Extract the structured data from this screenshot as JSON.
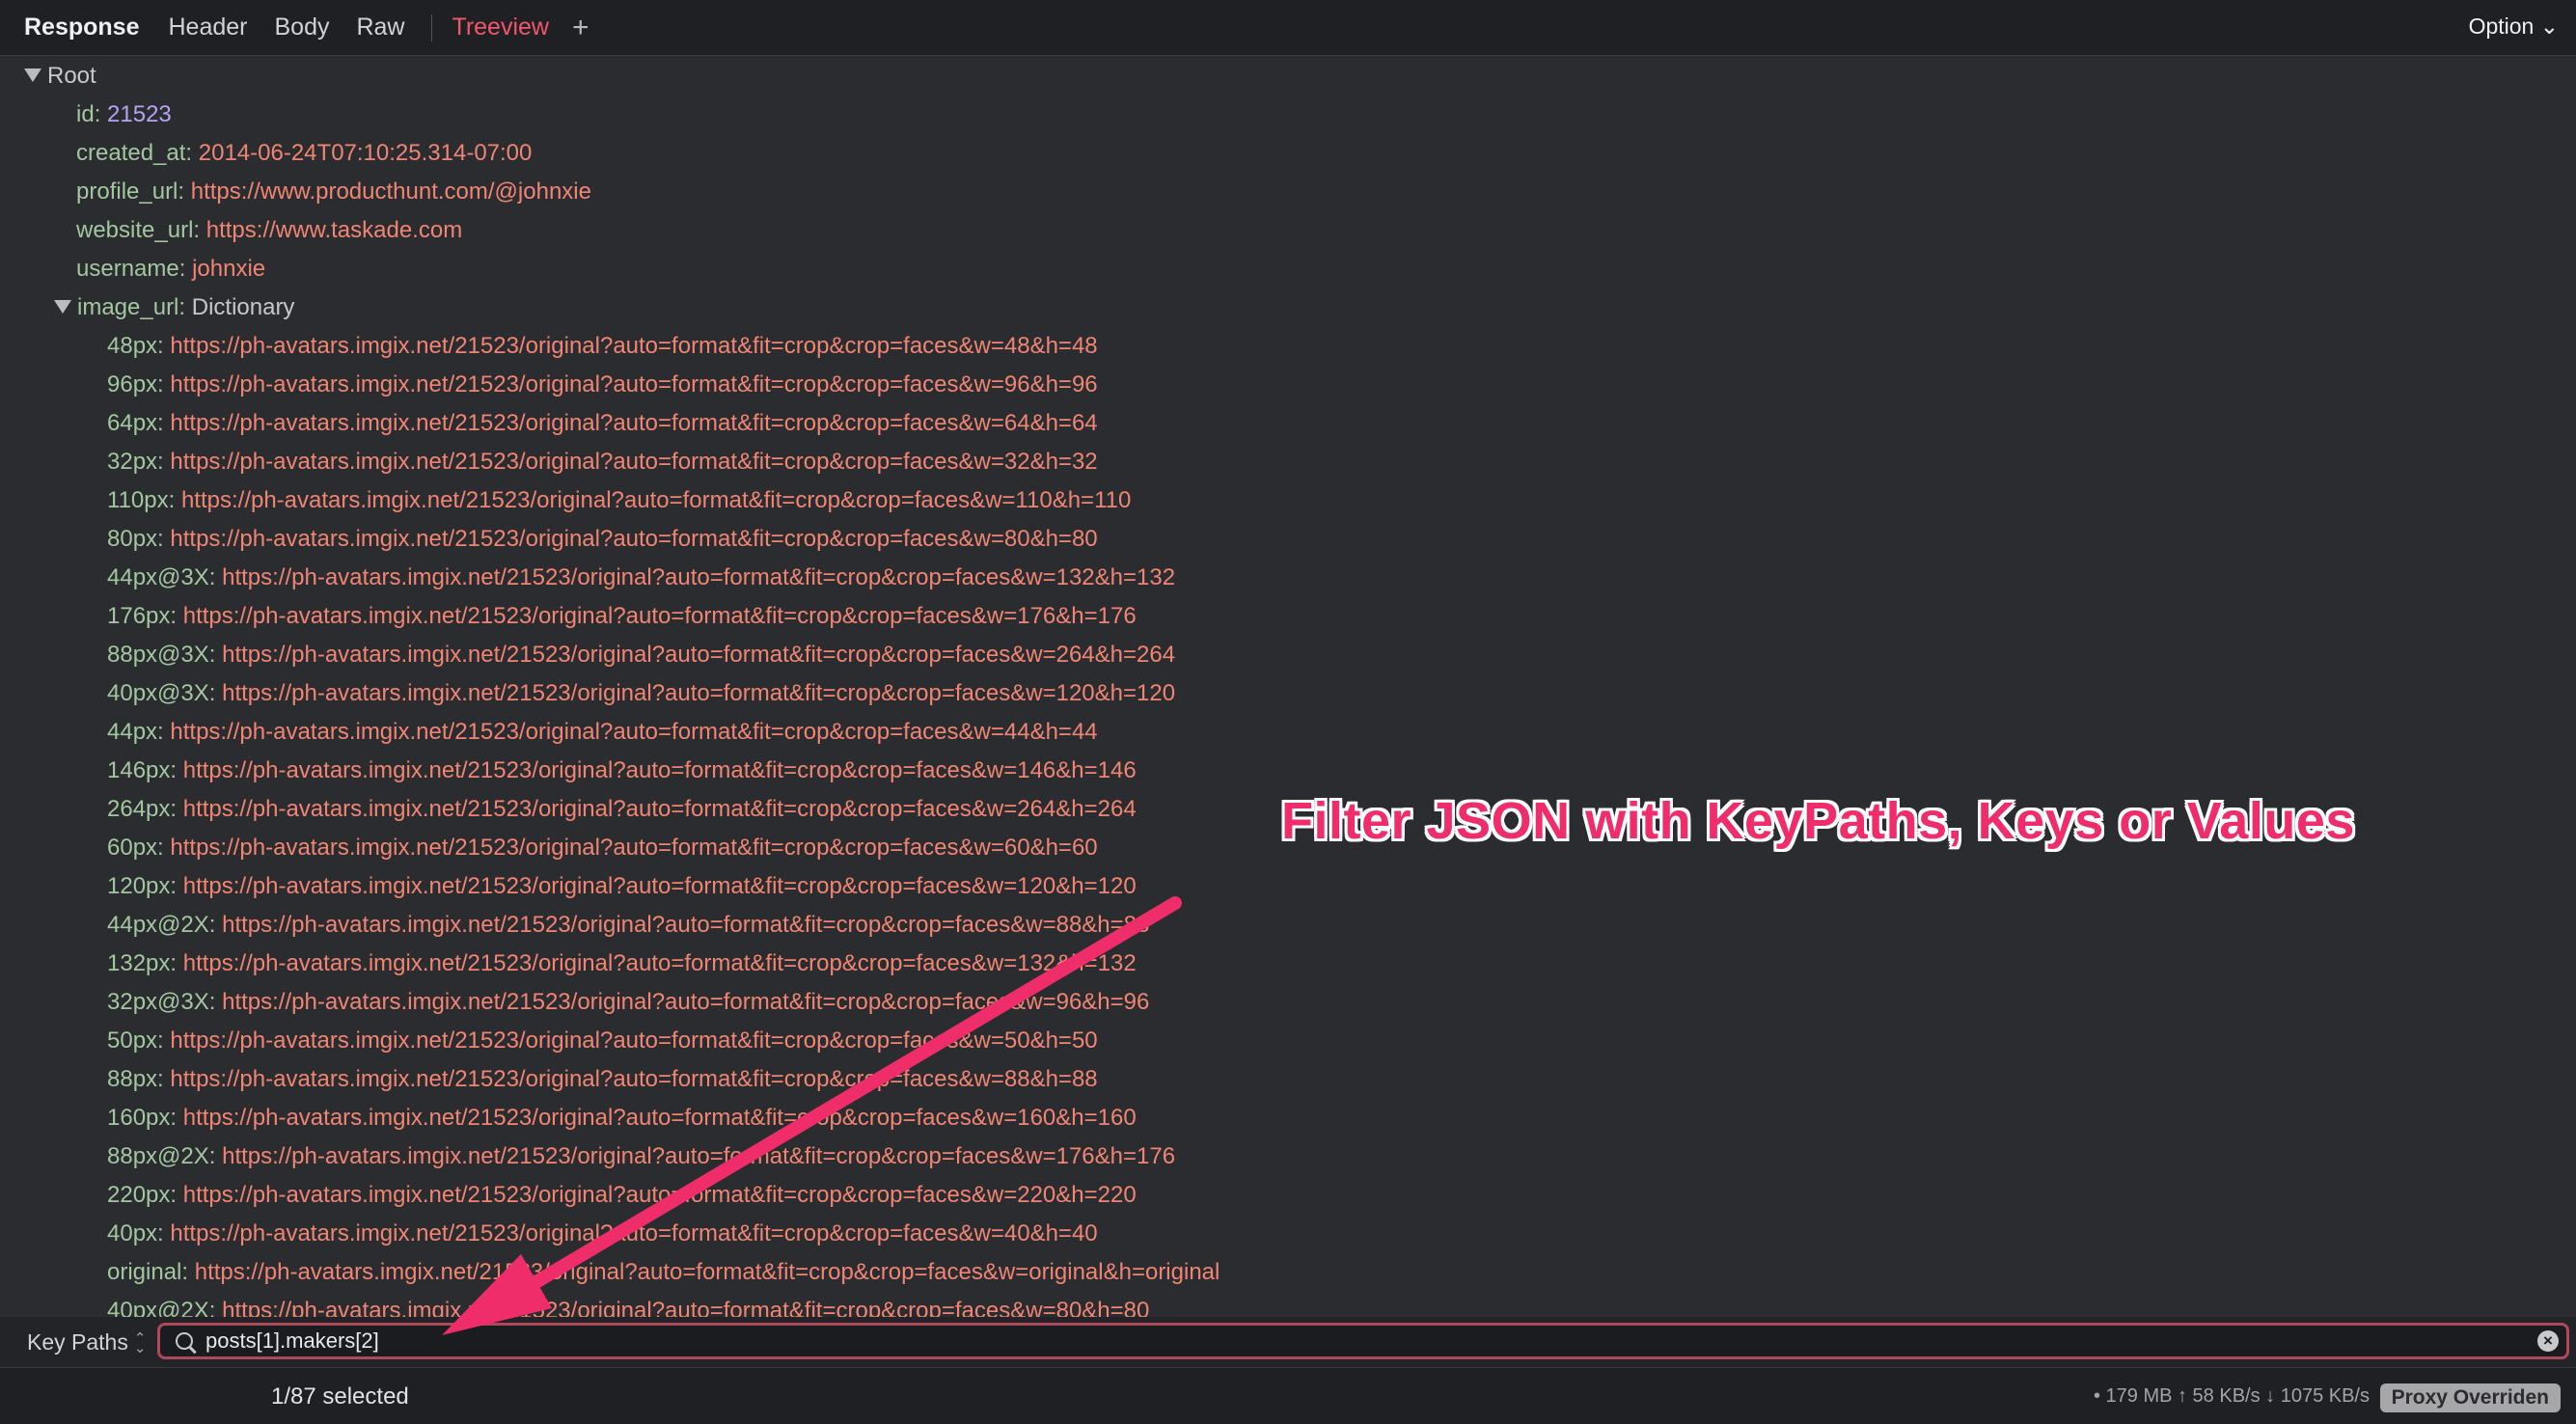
{
  "tabs": {
    "response": "Response",
    "header": "Header",
    "body": "Body",
    "raw": "Raw",
    "treeview": "Treeview",
    "add_icon": "plus-icon",
    "option": "Option"
  },
  "tree": {
    "root_label": "Root",
    "fields": [
      {
        "key": "id",
        "value": "21523",
        "kind": "number"
      },
      {
        "key": "created_at",
        "value": "2014-06-24T07:10:25.314-07:00",
        "kind": "string"
      },
      {
        "key": "profile_url",
        "value": "https://www.producthunt.com/@johnxie",
        "kind": "string"
      },
      {
        "key": "website_url",
        "value": "https://www.taskade.com",
        "kind": "string"
      },
      {
        "key": "username",
        "value": "johnxie",
        "kind": "string"
      }
    ],
    "image_url": {
      "key": "image_url",
      "type_label": "Dictionary",
      "items": [
        {
          "key": "48px",
          "value": "https://ph-avatars.imgix.net/21523/original?auto=format&fit=crop&crop=faces&w=48&h=48"
        },
        {
          "key": "96px",
          "value": "https://ph-avatars.imgix.net/21523/original?auto=format&fit=crop&crop=faces&w=96&h=96"
        },
        {
          "key": "64px",
          "value": "https://ph-avatars.imgix.net/21523/original?auto=format&fit=crop&crop=faces&w=64&h=64"
        },
        {
          "key": "32px",
          "value": "https://ph-avatars.imgix.net/21523/original?auto=format&fit=crop&crop=faces&w=32&h=32"
        },
        {
          "key": "110px",
          "value": "https://ph-avatars.imgix.net/21523/original?auto=format&fit=crop&crop=faces&w=110&h=110"
        },
        {
          "key": "80px",
          "value": "https://ph-avatars.imgix.net/21523/original?auto=format&fit=crop&crop=faces&w=80&h=80"
        },
        {
          "key": "44px@3X",
          "value": "https://ph-avatars.imgix.net/21523/original?auto=format&fit=crop&crop=faces&w=132&h=132"
        },
        {
          "key": "176px",
          "value": "https://ph-avatars.imgix.net/21523/original?auto=format&fit=crop&crop=faces&w=176&h=176"
        },
        {
          "key": "88px@3X",
          "value": "https://ph-avatars.imgix.net/21523/original?auto=format&fit=crop&crop=faces&w=264&h=264"
        },
        {
          "key": "40px@3X",
          "value": "https://ph-avatars.imgix.net/21523/original?auto=format&fit=crop&crop=faces&w=120&h=120"
        },
        {
          "key": "44px",
          "value": "https://ph-avatars.imgix.net/21523/original?auto=format&fit=crop&crop=faces&w=44&h=44"
        },
        {
          "key": "146px",
          "value": "https://ph-avatars.imgix.net/21523/original?auto=format&fit=crop&crop=faces&w=146&h=146"
        },
        {
          "key": "264px",
          "value": "https://ph-avatars.imgix.net/21523/original?auto=format&fit=crop&crop=faces&w=264&h=264"
        },
        {
          "key": "60px",
          "value": "https://ph-avatars.imgix.net/21523/original?auto=format&fit=crop&crop=faces&w=60&h=60"
        },
        {
          "key": "120px",
          "value": "https://ph-avatars.imgix.net/21523/original?auto=format&fit=crop&crop=faces&w=120&h=120"
        },
        {
          "key": "44px@2X",
          "value": "https://ph-avatars.imgix.net/21523/original?auto=format&fit=crop&crop=faces&w=88&h=88"
        },
        {
          "key": "132px",
          "value": "https://ph-avatars.imgix.net/21523/original?auto=format&fit=crop&crop=faces&w=132&h=132"
        },
        {
          "key": "32px@3X",
          "value": "https://ph-avatars.imgix.net/21523/original?auto=format&fit=crop&crop=faces&w=96&h=96"
        },
        {
          "key": "50px",
          "value": "https://ph-avatars.imgix.net/21523/original?auto=format&fit=crop&crop=faces&w=50&h=50"
        },
        {
          "key": "88px",
          "value": "https://ph-avatars.imgix.net/21523/original?auto=format&fit=crop&crop=faces&w=88&h=88"
        },
        {
          "key": "160px",
          "value": "https://ph-avatars.imgix.net/21523/original?auto=format&fit=crop&crop=faces&w=160&h=160"
        },
        {
          "key": "88px@2X",
          "value": "https://ph-avatars.imgix.net/21523/original?auto=format&fit=crop&crop=faces&w=176&h=176"
        },
        {
          "key": "220px",
          "value": "https://ph-avatars.imgix.net/21523/original?auto=format&fit=crop&crop=faces&w=220&h=220"
        },
        {
          "key": "40px",
          "value": "https://ph-avatars.imgix.net/21523/original?auto=format&fit=crop&crop=faces&w=40&h=40"
        },
        {
          "key": "original",
          "value": "https://ph-avatars.imgix.net/21523/original?auto=format&fit=crop&crop=faces&w=original&h=original"
        },
        {
          "key": "40px@2X",
          "value": "https://ph-avatars.imgix.net/21523/original?auto=format&fit=crop&crop=faces&w=80&h=80"
        }
      ]
    }
  },
  "filter": {
    "mode_label": "Key Paths",
    "query": "posts[1].makers[2]",
    "search_icon": "search-icon",
    "clear_icon": "clear-icon"
  },
  "status": {
    "selected": "1/87 selected",
    "stats": "• 179 MB ↑ 58 KB/s ↓ 1075 KB/s",
    "proxy_badge": "Proxy Overriden"
  },
  "annotation": {
    "text": "Filter JSON with KeyPaths, Keys or Values",
    "color": "#f02d6b"
  },
  "colors": {
    "background": "#2b2c30",
    "key": "#a3c7a0",
    "string_value": "#f08574",
    "number_value": "#b6a4f2",
    "active_tab": "#f0576a",
    "search_border": "#b0485b"
  }
}
